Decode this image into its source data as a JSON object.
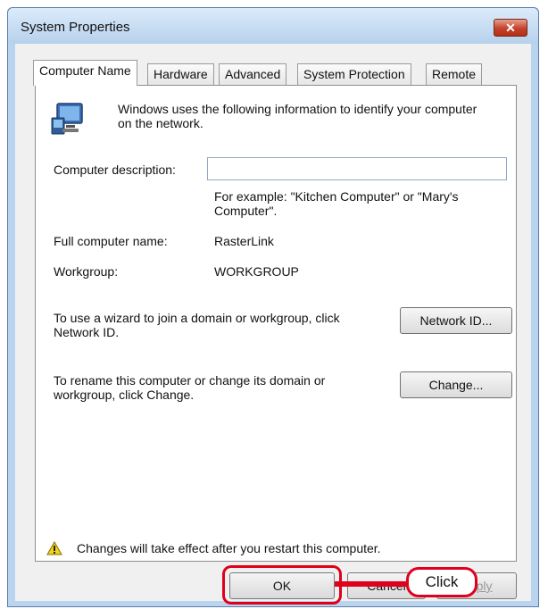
{
  "window": {
    "title": "System Properties",
    "close_glyph": "✕"
  },
  "tabs": [
    {
      "label": "Computer Name",
      "active": true
    },
    {
      "label": "Hardware",
      "active": false
    },
    {
      "label": "Advanced",
      "active": false
    },
    {
      "label": "System Protection",
      "active": false
    },
    {
      "label": "Remote",
      "active": false
    }
  ],
  "panel": {
    "intro_line1": "Windows uses the following information to identify your computer",
    "intro_line2": "on the network.",
    "description_label": "Computer description:",
    "description_value": "",
    "example_line1": "For example: \"Kitchen Computer\" or \"Mary's",
    "example_line2": "Computer\".",
    "full_name_label": "Full computer name:",
    "full_name_value": "RasterLink",
    "workgroup_label": "Workgroup:",
    "workgroup_value": "WORKGROUP",
    "network_text_line1": "To use a wizard to join a domain or workgroup, click",
    "network_text_line2": "Network ID.",
    "network_button": "Network ID...",
    "rename_text_line1": "To rename this computer or change its domain or",
    "rename_text_line2": "workgroup, click Change.",
    "change_button": "Change...",
    "warning_text": "Changes will take effect after you restart this computer."
  },
  "buttons": {
    "ok": "OK",
    "cancel": "Cancel",
    "apply": "Apply"
  },
  "annotation": {
    "callout": "Click"
  },
  "icons": {
    "computer": "computer-icon",
    "warning": "warning-icon",
    "close": "close-icon"
  },
  "colors": {
    "highlight": "#e0001b",
    "frame": "#b9d4ee"
  }
}
